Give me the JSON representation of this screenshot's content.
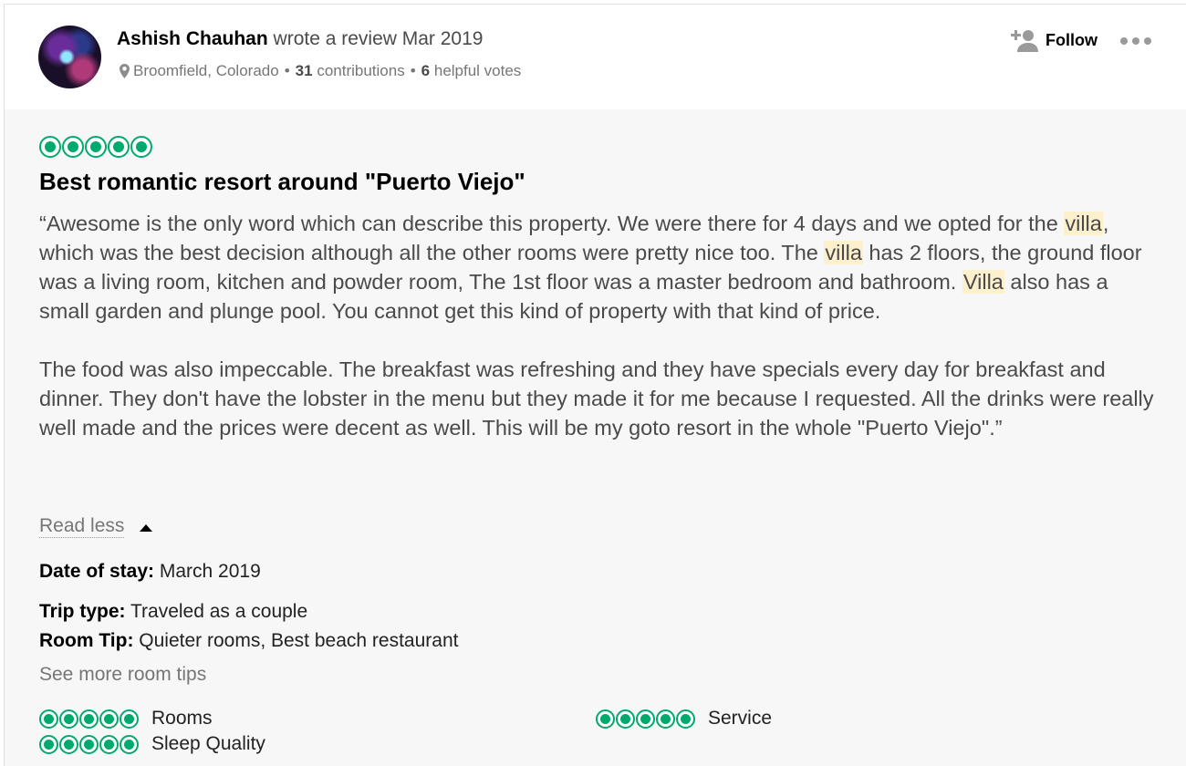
{
  "reviewer": {
    "name": "Ashish Chauhan",
    "action": "wrote a review Mar 2019",
    "location": "Broomfield, Colorado",
    "contributions_count": "31",
    "contributions_label": "contributions",
    "helpful_count": "6",
    "helpful_label": "helpful votes"
  },
  "actions": {
    "follow_label": "Follow"
  },
  "review": {
    "rating": 5,
    "title": "Best romantic resort around \"Puerto Viejo\"",
    "p1_a": "“Awesome is the only word which can describe this property. We were there for 4 days and we opted for the ",
    "p1_h1": "villa",
    "p1_b": ", which was the best decision although all the other rooms were pretty nice too. The ",
    "p1_h2": "villa",
    "p1_c": " has 2 floors, the ground floor was a living room, kitchen and powder room, The 1st floor was a master bedroom and bathroom. ",
    "p1_h3": "Villa",
    "p1_d": " also has a small garden and plunge pool. You cannot get this kind of property with that kind of price.",
    "p2": "The food was also impeccable. The breakfast was refreshing and they have specials every day for breakfast and dinner. They don't have the lobster in the menu but they made it for me because I requested. All the drinks were really well made and the prices were decent as well. This will be my goto resort in the whole \"Puerto Viejo\".”",
    "read_less": "Read less"
  },
  "details": {
    "date_label": "Date of stay:",
    "date_value": "March 2019",
    "trip_label": "Trip type:",
    "trip_value": "Traveled as a couple",
    "tip_label": "Room Tip:",
    "tip_value": "Quieter rooms, Best beach restaurant",
    "see_more": "See more room tips"
  },
  "sub_ratings": [
    {
      "label": "Rooms",
      "rating": 5
    },
    {
      "label": "Service",
      "rating": 5
    },
    {
      "label": "Sleep Quality",
      "rating": 5
    }
  ],
  "colors": {
    "bubble": "#00aa6c",
    "highlight": "#fdf0cc",
    "text": "#4a4a4a",
    "muted": "#767676"
  },
  "icons": [
    "map-pin-icon",
    "add-user-icon",
    "more-options-icon",
    "caret-up-icon",
    "rating-bubble-icon"
  ]
}
